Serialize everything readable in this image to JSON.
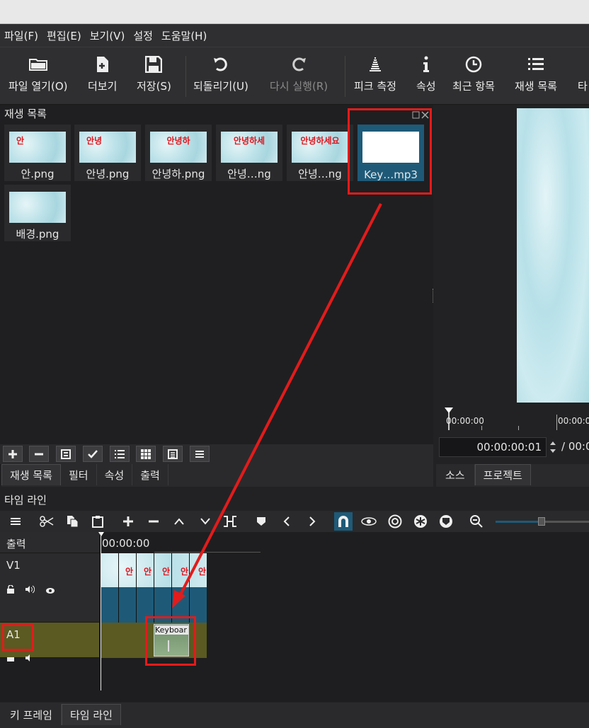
{
  "menu": [
    "파일(F)",
    "편집(E)",
    "보기(V)",
    "설정",
    "도움말(H)"
  ],
  "toolbar": {
    "open": "파일 열기(O)",
    "more": "더보기",
    "save": "저장(S)",
    "undo": "되돌리기(U)",
    "redo": "다시 실행(R)",
    "peak": "피크 측정",
    "properties": "속성",
    "recent": "최근 항목",
    "playlist": "재생 목록",
    "cutoff": "타"
  },
  "playlist": {
    "title": "재생 목록",
    "items": [
      {
        "caption": "안.png",
        "text": "안"
      },
      {
        "caption": "안녕.png",
        "text": "안녕"
      },
      {
        "caption": "안녕하.png",
        "text": "안녕하"
      },
      {
        "caption": "안녕…ng",
        "text": "안녕하세"
      },
      {
        "caption": "안녕…ng",
        "text": "안녕하세요"
      },
      {
        "caption": "Key…mp3",
        "text": ""
      },
      {
        "caption": "배경.png",
        "text": ""
      }
    ],
    "tabs": [
      "재생 목록",
      "필터",
      "속성",
      "출력"
    ]
  },
  "viewer": {
    "ruler_start": "00:00:00",
    "ruler_next": "00:00:0",
    "timecode": "00:00:00:01",
    "duration": "/ 00:0",
    "tabs": [
      "소스",
      "프로젝트"
    ]
  },
  "timeline": {
    "title": "타임 라인",
    "output_label": "출력",
    "ruler_time": "00:00:00",
    "v1_label": "V1",
    "a1_label": "A1",
    "clip_text": "안",
    "audio_clip_label": "Keyboar"
  },
  "bottom_tabs": [
    "키 프레임",
    "타임 라인"
  ],
  "colors": {
    "annotation": "#e31b1b",
    "selected": "#1e5a78",
    "audio_track": "#5a5a22"
  }
}
